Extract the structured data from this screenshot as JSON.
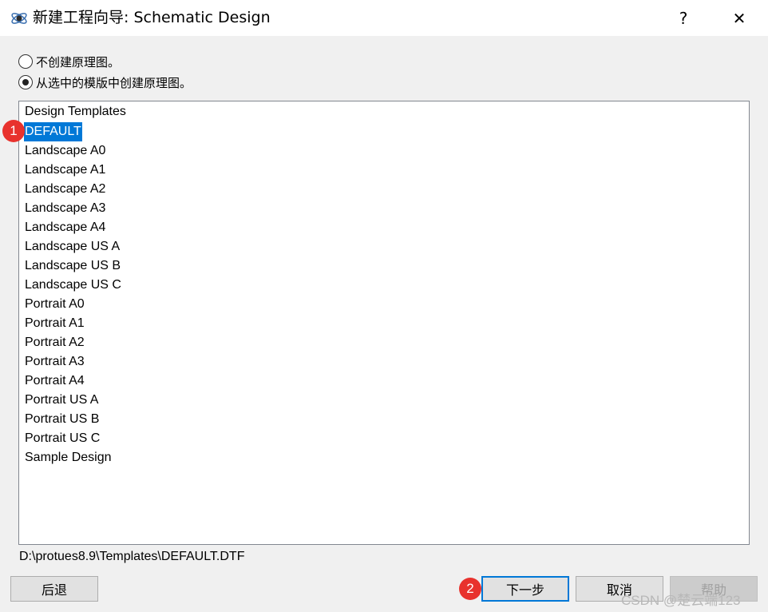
{
  "window": {
    "title": "新建工程向导: Schematic Design",
    "help_glyph": "?",
    "close_glyph": "✕"
  },
  "options": [
    {
      "label": "不创建原理图。",
      "checked": false
    },
    {
      "label": "从选中的模版中创建原理图。",
      "checked": true
    }
  ],
  "templates": {
    "header": "Design Templates",
    "items": [
      "DEFAULT",
      "Landscape A0",
      "Landscape A1",
      "Landscape A2",
      "Landscape A3",
      "Landscape A4",
      "Landscape US A",
      "Landscape US B",
      "Landscape US C",
      "Portrait A0",
      "Portrait A1",
      "Portrait A2",
      "Portrait A3",
      "Portrait A4",
      "Portrait US A",
      "Portrait US B",
      "Portrait US C",
      "Sample Design"
    ],
    "selected": "DEFAULT"
  },
  "template_path": "D:\\protues8.9\\Templates\\DEFAULT.DTF",
  "buttons": {
    "back": "后退",
    "next": "下一步",
    "cancel": "取消",
    "help": "帮助"
  },
  "annotations": [
    "1",
    "2"
  ],
  "watermark": "CSDN @楚云端123",
  "colors": {
    "selection": "#0078d7",
    "annotation": "#e8322d"
  }
}
